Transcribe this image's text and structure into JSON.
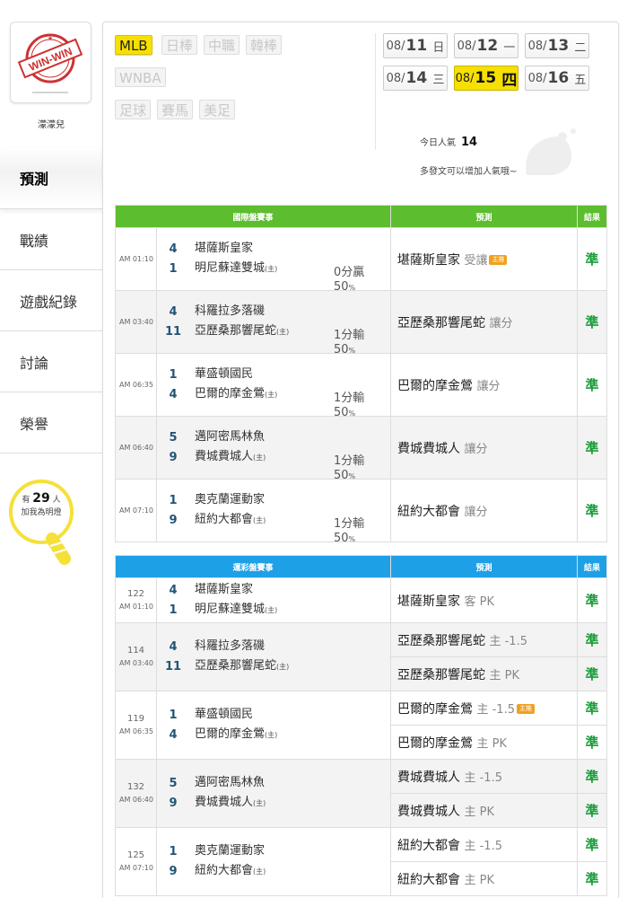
{
  "user": {
    "name": "濛濛兒",
    "logo_text": "WIN-WIN"
  },
  "nav": [
    {
      "label": "預測"
    },
    {
      "label": "戰績"
    },
    {
      "label": "遊戲紀錄"
    },
    {
      "label": "討論"
    },
    {
      "label": "榮譽"
    }
  ],
  "fans": {
    "prefix": "有",
    "count": "29",
    "suffix": "人",
    "line2": "加我為明燈"
  },
  "categories": [
    {
      "label": "MLB",
      "active": true
    },
    {
      "label": "日棒"
    },
    {
      "label": "中職"
    },
    {
      "label": "韓棒"
    },
    {
      "label": "WNBA"
    },
    {
      "label": "足球"
    },
    {
      "label": "賽馬"
    },
    {
      "label": "美足"
    }
  ],
  "dates": [
    {
      "md": "08/",
      "d": "11",
      "w": "日"
    },
    {
      "md": "08/",
      "d": "12",
      "w": "一"
    },
    {
      "md": "08/",
      "d": "13",
      "w": "二"
    },
    {
      "md": "08/",
      "d": "14",
      "w": "三"
    },
    {
      "md": "08/",
      "d": "15",
      "w": "四",
      "active": true
    },
    {
      "md": "08/",
      "d": "16",
      "w": "五"
    }
  ],
  "popularity": {
    "label": "今日人氣",
    "count": "14",
    "message": "多發文可以增加人氣哦~"
  },
  "intl": {
    "headers": {
      "event": "國際盤賽事",
      "pred": "預測",
      "result": "結果"
    },
    "rows": [
      {
        "time": "AM 01:10",
        "s1": "4",
        "t1": "堪薩斯皇家",
        "s2": "1",
        "t2": "明尼蘇達雙城",
        "host": "(主)",
        "odds": "0分贏",
        "pct": "50",
        "pct_unit": "%",
        "pred": "堪薩斯皇家",
        "sub": "受讓",
        "badge": true,
        "result": "準"
      },
      {
        "time": "AM 03:40",
        "s1": "4",
        "t1": "科羅拉多落磯",
        "s2": "11",
        "t2": "亞歷桑那響尾蛇",
        "host": "(主)",
        "odds": "1分輸",
        "pct": "50",
        "pct_unit": "%",
        "pred": "亞歷桑那響尾蛇",
        "sub": "讓分",
        "result": "準"
      },
      {
        "time": "AM 06:35",
        "s1": "1",
        "t1": "華盛頓國民",
        "s2": "4",
        "t2": "巴爾的摩金鶯",
        "host": "(主)",
        "odds": "1分輸",
        "pct": "50",
        "pct_unit": "%",
        "pred": "巴爾的摩金鶯",
        "sub": "讓分",
        "result": "準"
      },
      {
        "time": "AM 06:40",
        "s1": "5",
        "t1": "邁阿密馬林魚",
        "s2": "9",
        "t2": "費城費城人",
        "host": "(主)",
        "odds": "1分輸",
        "pct": "50",
        "pct_unit": "%",
        "pred": "費城費城人",
        "sub": "讓分",
        "result": "準"
      },
      {
        "time": "AM 07:10",
        "s1": "1",
        "t1": "奧克蘭運動家",
        "s2": "9",
        "t2": "紐約大都會",
        "host": "(主)",
        "odds": "1分輸",
        "pct": "50",
        "pct_unit": "%",
        "pred": "紐約大都會",
        "sub": "讓分",
        "result": "準"
      }
    ]
  },
  "lottery": {
    "headers": {
      "event": "運彩盤賽事",
      "pred": "預測",
      "result": "結果"
    },
    "rows": [
      {
        "num": "122",
        "time": "AM 01:10",
        "s1": "4",
        "t1": "堪薩斯皇家",
        "s2": "1",
        "t2": "明尼蘇達雙城",
        "host": "(主)",
        "preds": [
          {
            "pred": "堪薩斯皇家",
            "sub": "客 PK",
            "result": "準"
          }
        ]
      },
      {
        "num": "114",
        "time": "AM 03:40",
        "s1": "4",
        "t1": "科羅拉多落磯",
        "s2": "11",
        "t2": "亞歷桑那響尾蛇",
        "host": "(主)",
        "preds": [
          {
            "pred": "亞歷桑那響尾蛇",
            "sub": "主 -1.5",
            "result": "準"
          },
          {
            "pred": "亞歷桑那響尾蛇",
            "sub": "主 PK",
            "result": "準"
          }
        ]
      },
      {
        "num": "119",
        "time": "AM 06:35",
        "s1": "1",
        "t1": "華盛頓國民",
        "s2": "4",
        "t2": "巴爾的摩金鶯",
        "host": "(主)",
        "preds": [
          {
            "pred": "巴爾的摩金鶯",
            "sub": "主 -1.5",
            "badge": true,
            "result": "準"
          },
          {
            "pred": "巴爾的摩金鶯",
            "sub": "主 PK",
            "result": "準"
          }
        ]
      },
      {
        "num": "132",
        "time": "AM 06:40",
        "s1": "5",
        "t1": "邁阿密馬林魚",
        "s2": "9",
        "t2": "費城費城人",
        "host": "(主)",
        "preds": [
          {
            "pred": "費城費城人",
            "sub": "主 -1.5",
            "result": "準"
          },
          {
            "pred": "費城費城人",
            "sub": "主 PK",
            "result": "準"
          }
        ]
      },
      {
        "num": "125",
        "time": "AM 07:10",
        "s1": "1",
        "t1": "奧克蘭運動家",
        "s2": "9",
        "t2": "紐約大都會",
        "host": "(主)",
        "preds": [
          {
            "pred": "紐約大都會",
            "sub": "主 -1.5",
            "result": "準"
          },
          {
            "pred": "紐約大都會",
            "sub": "主 PK",
            "result": "準"
          }
        ]
      }
    ]
  }
}
